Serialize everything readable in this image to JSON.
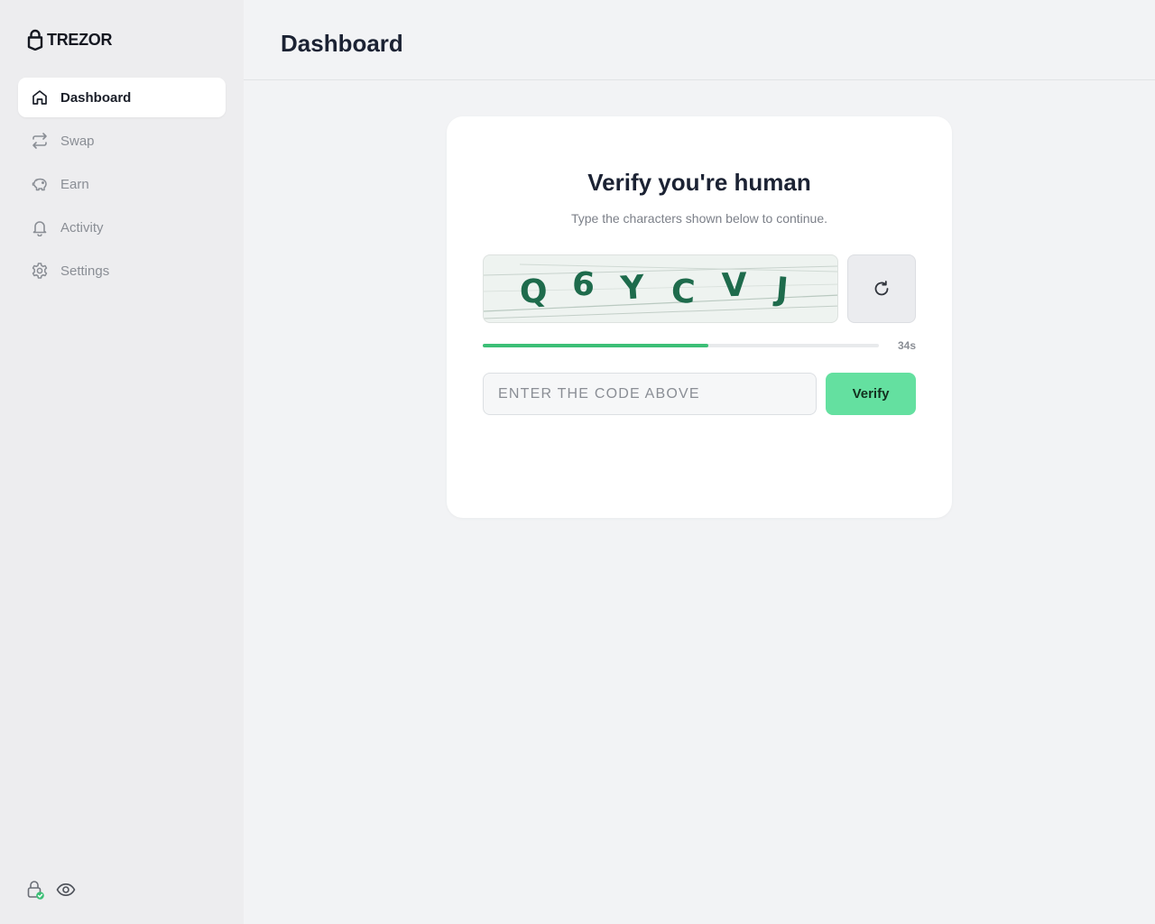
{
  "brand": {
    "name": "TREZOR",
    "icon": "trezor-lock-icon"
  },
  "header": {
    "title": "Dashboard"
  },
  "sidebar": {
    "items": [
      {
        "label": "Dashboard",
        "icon": "home-icon",
        "active": true
      },
      {
        "label": "Swap",
        "icon": "swap-arrows-icon",
        "active": false
      },
      {
        "label": "Earn",
        "icon": "piggy-bank-icon",
        "active": false
      },
      {
        "label": "Activity",
        "icon": "bell-icon",
        "active": false
      },
      {
        "label": "Settings",
        "icon": "gear-icon",
        "active": false
      }
    ],
    "footer_icons": [
      "lock-verified-icon",
      "eye-icon"
    ]
  },
  "captcha": {
    "title": "Verify you're human",
    "subtitle": "Type the characters shown below to continue.",
    "characters": [
      "Q",
      "6",
      "Y",
      "C",
      "V",
      "J"
    ],
    "timer_text": "34s",
    "progress_fraction": 0.57,
    "input_placeholder": "ENTER THE CODE ABOVE",
    "input_value": "",
    "verify_label": "Verify",
    "refresh_icon": "refresh-icon"
  },
  "colors": {
    "accent": "#3cbf76",
    "verify_button": "#64e0a0",
    "captcha_text": "#1e6b4c"
  }
}
